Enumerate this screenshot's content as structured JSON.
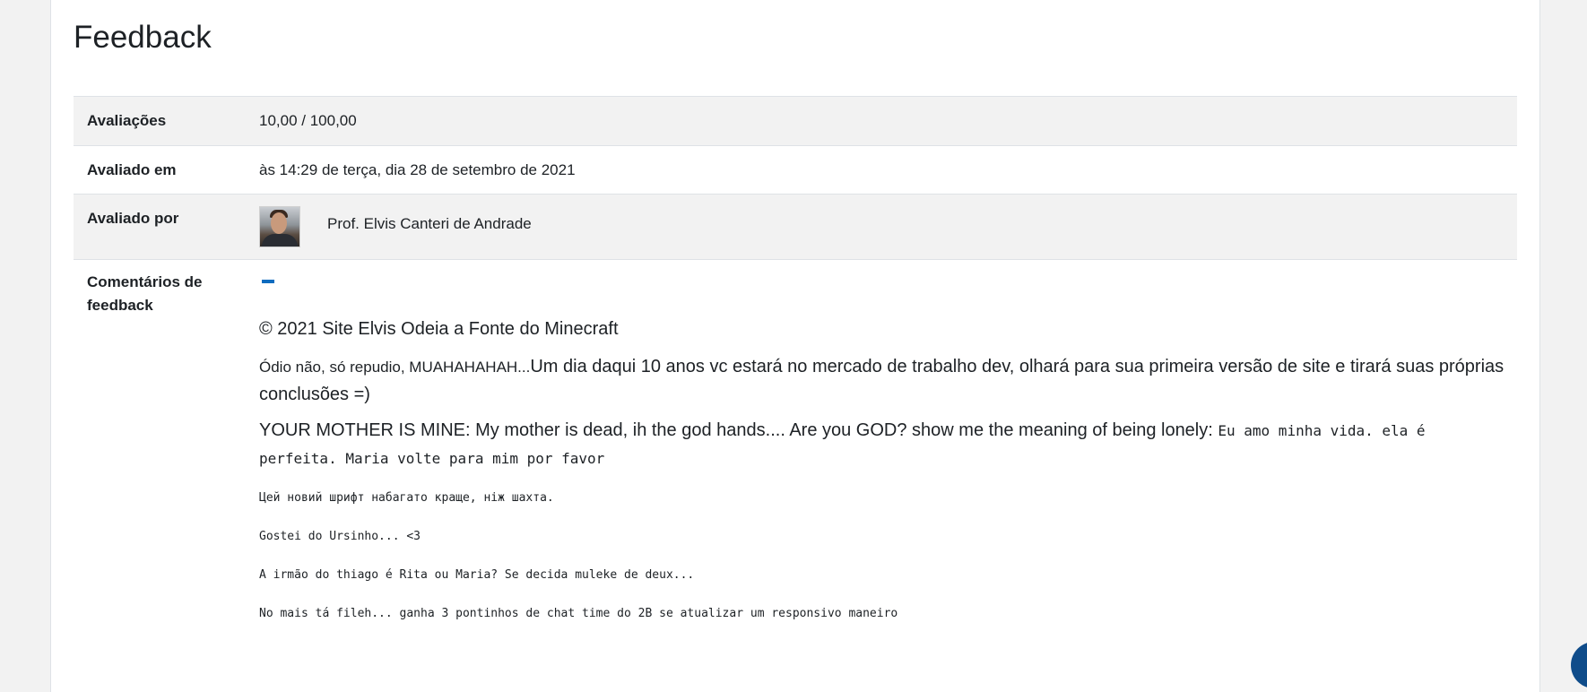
{
  "page": {
    "title": "Feedback"
  },
  "feedback": {
    "grade_label": "Avaliações",
    "grade_value": "10,00 / 100,00",
    "graded_on_label": "Avaliado em",
    "graded_on_value": "às 14:29 de terça, dia 28 de setembro de 2021",
    "graded_by_label": "Avaliado por",
    "grader_name": "Prof. Elvis Canteri de Andrade",
    "comments_label": "Comentários de feedback"
  },
  "comments": {
    "copyright": "© 2021 Site Elvis Odeia a Fonte do Minecraft",
    "para1_small": "Ódio não, só repudio, MUAHAHAHAH...",
    "para1_rest": "Um dia daqui 10 anos vc estará no mercado de trabalho dev, olhará para sua primeira versão de site e tirará suas próprias conclusões =)",
    "para2_text": "YOUR MOTHER IS MINE: My mother is dead, ih the god hands.... Are you GOD? show me the meaning of being lonely: ",
    "para2_mono": "Eu amo minha vida. ela é perfeita. Maria volte para mim por favor",
    "line_ukrainian": "Цей новий шрифт набагато краще, ніж шахта.",
    "line_ursinho": "Gostei do Ursinho... <3",
    "line_thiago": "A irmão do thiago é Rita ou Maria? Se decida muleke de deux...",
    "line_final": "No mais tá fileh... ganha 3 pontinhos de chat time do 2B se atualizar um responsivo maneiro"
  },
  "colors": {
    "accent": "#0f6cbf",
    "row_alt": "#f2f2f2",
    "border": "#dee2e6"
  },
  "icons": {
    "avatar": "grader-avatar",
    "chat": "chat-bubble-icon"
  }
}
